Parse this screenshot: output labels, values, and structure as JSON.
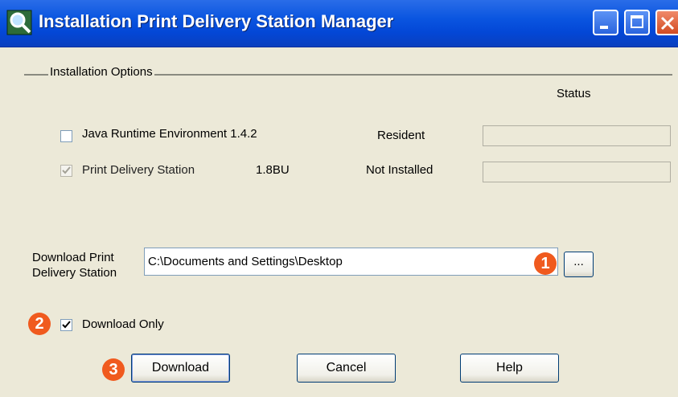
{
  "window": {
    "title": "Installation Print Delivery Station Manager"
  },
  "group": {
    "label": "Installation Options",
    "status_header": "Status"
  },
  "components": [
    {
      "name": "Java Runtime Environment 1.4.2",
      "version": "",
      "state": "Resident",
      "checked": false,
      "enabled": true
    },
    {
      "name": "Print Delivery Station",
      "version": "1.8BU",
      "state": "Not Installed",
      "checked": true,
      "enabled": false
    }
  ],
  "download": {
    "label_line1": "Download Print",
    "label_line2": "Delivery Station",
    "path": "C:\\Documents and Settings\\Desktop",
    "browse_label": "...",
    "download_only_label": "Download Only",
    "download_only_checked": true
  },
  "buttons": {
    "download": "Download",
    "cancel": "Cancel",
    "help": "Help"
  },
  "markers": [
    "1",
    "2",
    "3"
  ],
  "colors": {
    "titlebar": "#0a55e0",
    "marker": "#f05a1e",
    "window_bg": "#ece9d8"
  },
  "icons": {
    "app": "magnifier-icon",
    "minimize": "minimize-icon",
    "maximize": "maximize-icon",
    "close": "close-icon"
  }
}
